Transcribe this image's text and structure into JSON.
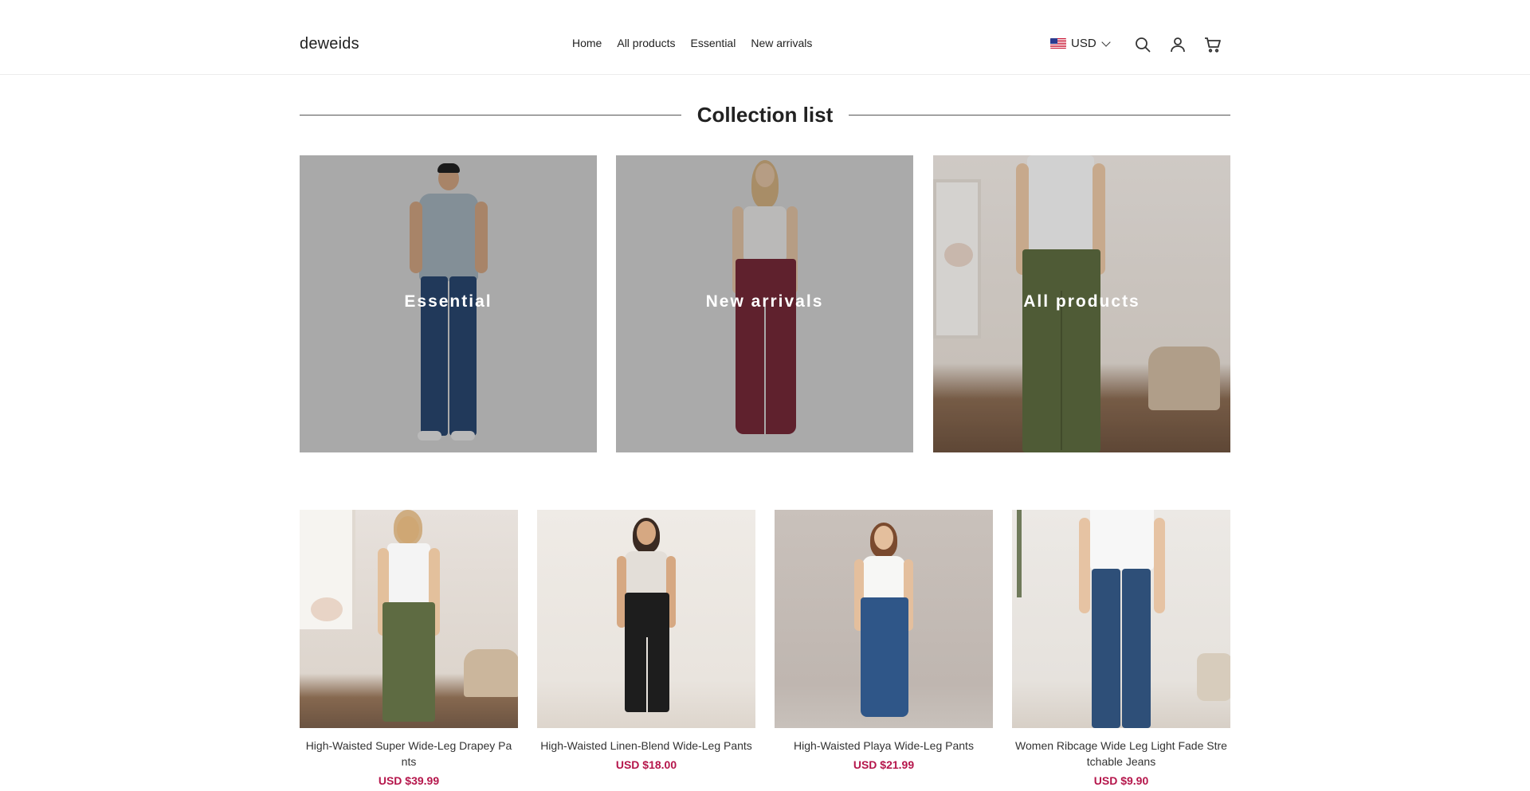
{
  "header": {
    "logo": "deweids",
    "nav": [
      "Home",
      "All products",
      "Essential",
      "New arrivals"
    ],
    "currency": "USD",
    "icons": [
      "search-icon",
      "account-icon",
      "cart-icon"
    ]
  },
  "collection_list": {
    "title": "Collection list",
    "tiles": [
      {
        "label": "Essential"
      },
      {
        "label": "New arrivals"
      },
      {
        "label": "All products"
      }
    ]
  },
  "products": [
    {
      "title": "High-Waisted Super Wide-Leg Drapey Pants",
      "price": "USD $39.99"
    },
    {
      "title": "High-Waisted Linen-Blend Wide-Leg Pants",
      "price": "USD $18.00"
    },
    {
      "title": "High-Waisted Playa Wide-Leg Pants",
      "price": "USD $21.99"
    },
    {
      "title": "Women Ribcage Wide Leg Light Fade Stretchable Jeans",
      "price": "USD $9.90"
    }
  ],
  "colors": {
    "price": "#b5164b",
    "text": "#222222",
    "border": "#ececec"
  }
}
